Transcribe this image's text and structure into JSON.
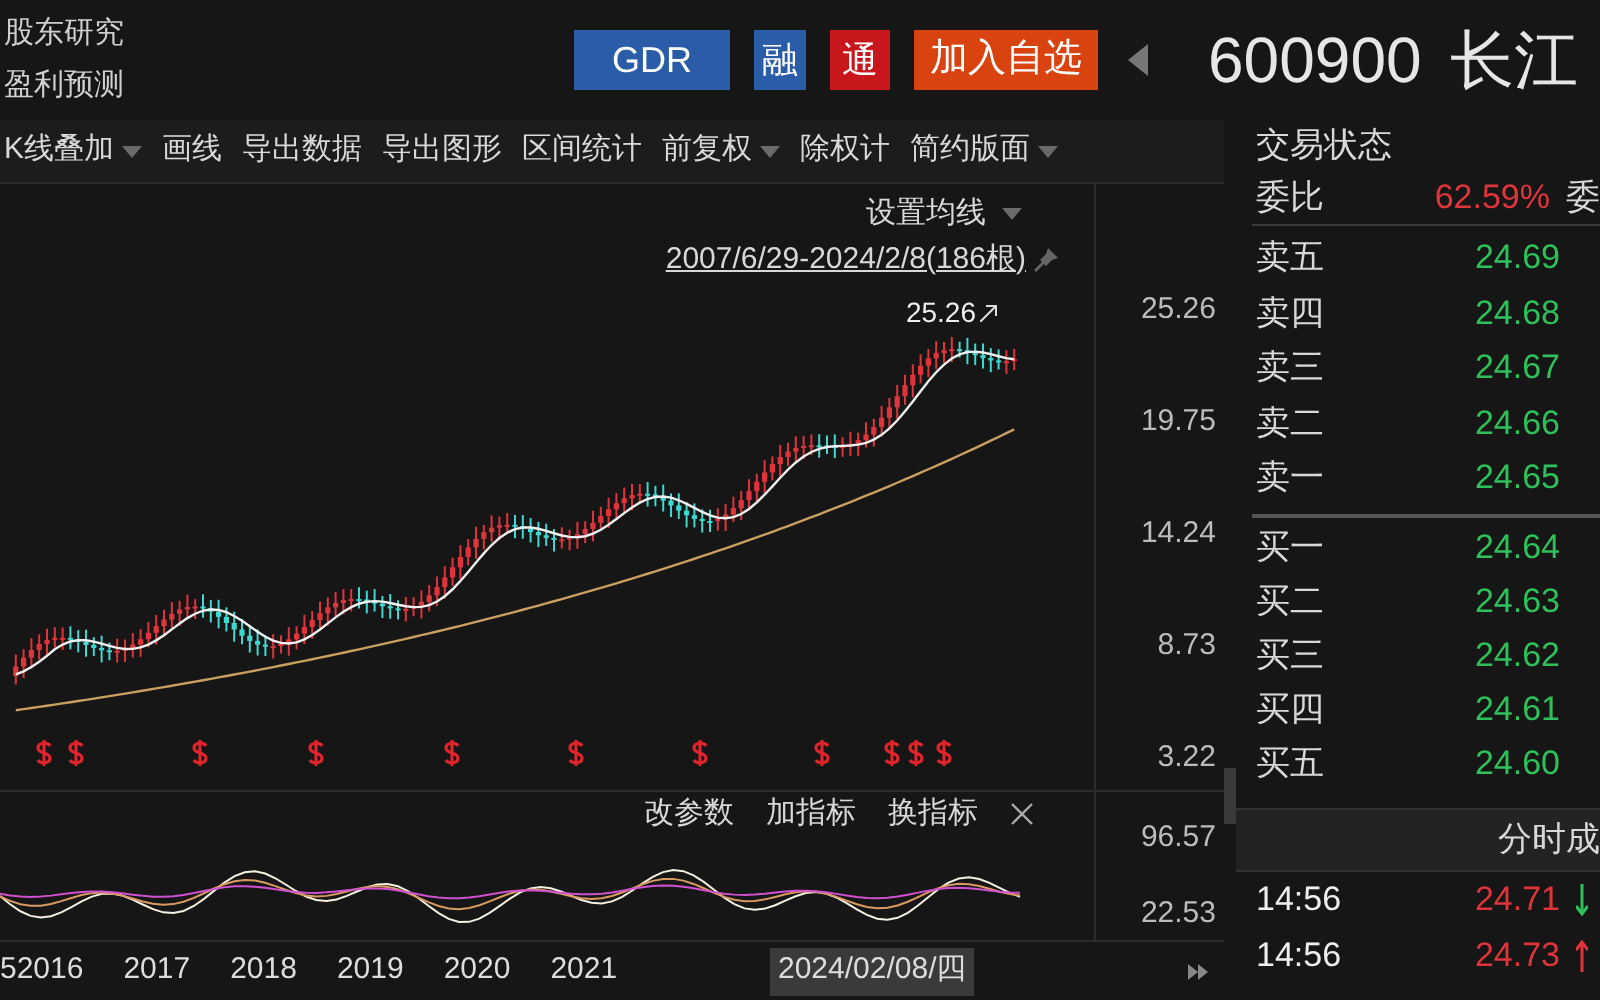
{
  "header": {
    "links": [
      "股东研究",
      "盈利预测"
    ],
    "badges": [
      {
        "label": "GDR",
        "kind": "gdr"
      },
      {
        "label": "融",
        "kind": "margin"
      },
      {
        "label": "通",
        "kind": "connect"
      }
    ],
    "watchlist_button": "加入自选",
    "stock_code": "600900",
    "stock_name": "长江"
  },
  "toolbar": [
    {
      "label": "K线叠加",
      "dropdown": true
    },
    {
      "label": "画线",
      "dropdown": false
    },
    {
      "label": "导出数据",
      "dropdown": false
    },
    {
      "label": "导出图形",
      "dropdown": false
    },
    {
      "label": "区间统计",
      "dropdown": false
    },
    {
      "label": "前复权",
      "dropdown": true
    },
    {
      "label": "除权计",
      "dropdown": false
    },
    {
      "label": "简约版面",
      "dropdown": true
    }
  ],
  "chart": {
    "ma_setting": "设置均线",
    "range": "2007/6/29-2024/2/8(186根)",
    "last_price_label": "25.26",
    "price_axis": [
      "25.26",
      "19.75",
      "14.24",
      "8.73",
      "3.22"
    ],
    "indicator": {
      "actions": [
        "改参数",
        "加指标",
        "换指标"
      ],
      "axis": [
        "96.57",
        "22.53"
      ]
    },
    "x_axis": [
      "52016",
      "2017",
      "2018",
      "2019",
      "2020",
      "2021"
    ],
    "cursor_date": "2024/02/08/四"
  },
  "order_book": {
    "title": "交易状态",
    "ratio_label": "委比",
    "ratio_value": "62.59%",
    "ratio_label_2": "委",
    "asks": [
      {
        "label": "卖五",
        "price": "24.69"
      },
      {
        "label": "卖四",
        "price": "24.68"
      },
      {
        "label": "卖三",
        "price": "24.67"
      },
      {
        "label": "卖二",
        "price": "24.66"
      },
      {
        "label": "卖一",
        "price": "24.65"
      }
    ],
    "bids": [
      {
        "label": "买一",
        "price": "24.64"
      },
      {
        "label": "买二",
        "price": "24.63"
      },
      {
        "label": "买三",
        "price": "24.62"
      },
      {
        "label": "买四",
        "price": "24.61"
      },
      {
        "label": "买五",
        "price": "24.60"
      }
    ]
  },
  "trades": {
    "title": "分时成",
    "rows": [
      {
        "time": "14:56",
        "price": "24.71",
        "kind": "down"
      },
      {
        "time": "14:56",
        "price": "24.73",
        "kind": "up"
      }
    ]
  }
}
